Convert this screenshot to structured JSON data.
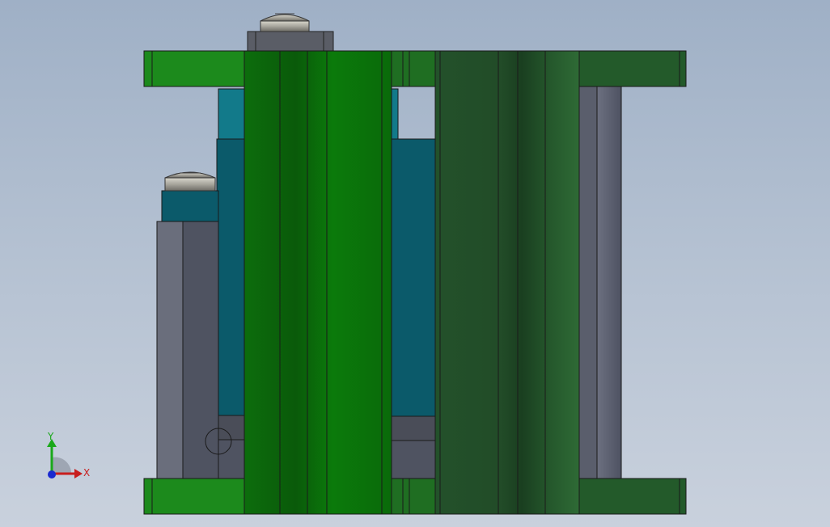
{
  "viewport": {
    "background_top": "#9fb0c6",
    "background_bottom": "#c9d1dd"
  },
  "model": {
    "colors": {
      "plate_green": "#1c8a1c",
      "plate_dark_green": "#235a2a",
      "column_green": "#0f7a0f",
      "teal_block": "#0b5a6a",
      "teal_light": "#127a8a",
      "gray_guide": "#5c6070",
      "screw_gray": "#8a8a84"
    },
    "parts": [
      "top-left-plate",
      "top-right-plate",
      "bottom-left-plate",
      "bottom-right-plate",
      "center-column",
      "right-block",
      "left-teal-block",
      "right-teal-block",
      "left-guide-rail",
      "right-guide-rail",
      "top-screw",
      "left-screw"
    ]
  },
  "triad": {
    "y_label": "Y",
    "x_label": "X",
    "y_color": "#1aa81a",
    "x_color": "#c81e1e",
    "origin_color": "#1a2ad0"
  }
}
